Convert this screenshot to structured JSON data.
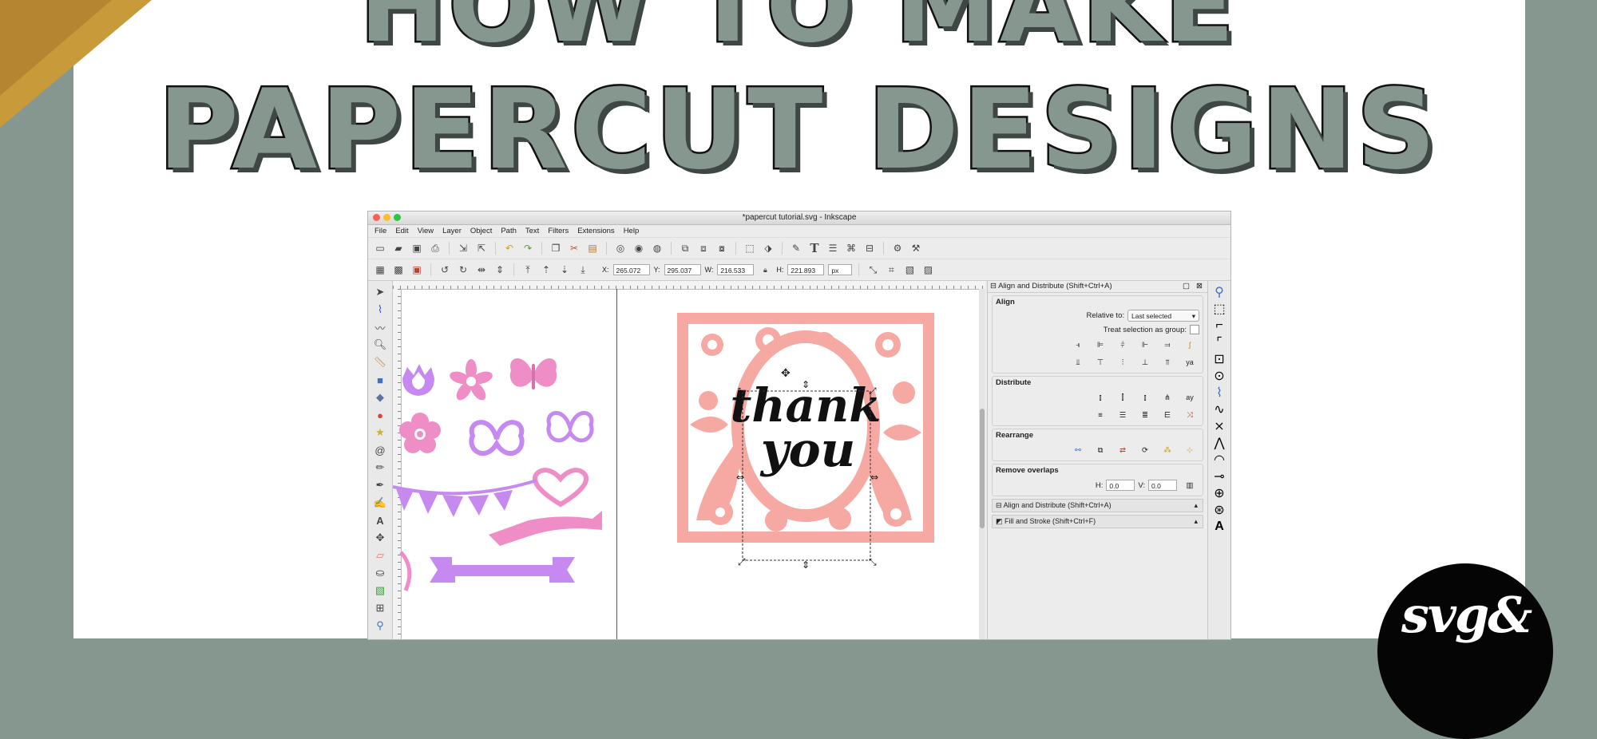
{
  "headline": {
    "line1": "HOW TO MAKE",
    "line2": "PAPERCUT DESIGNS"
  },
  "colors": {
    "sage": "#86978f",
    "peach": "#f6a9a3",
    "purple": "#c589f0",
    "pink": "#ef8ec6",
    "gold": "#c89a3a"
  },
  "window": {
    "title": "*papercut tutorial.svg - Inkscape",
    "menu": [
      "File",
      "Edit",
      "View",
      "Layer",
      "Object",
      "Path",
      "Text",
      "Filters",
      "Extensions",
      "Help"
    ]
  },
  "controls": {
    "x_label": "X:",
    "x_value": "265.072",
    "y_label": "Y:",
    "y_value": "295.037",
    "w_label": "W:",
    "w_value": "216.533",
    "h_label": "H:",
    "h_value": "221.893",
    "unit": "px"
  },
  "canvas": {
    "thank": "thank",
    "you": "you"
  },
  "dock": {
    "header": "Align and Distribute (Shift+Ctrl+A)",
    "align_label": "Align",
    "relative_label": "Relative to:",
    "relative_value": "Last selected",
    "treat_label": "Treat selection as group:",
    "distribute_label": "Distribute",
    "rearrange_label": "Rearrange",
    "overlap_label": "Remove overlaps",
    "h_label": "H:",
    "h_value": "0.0",
    "v_label": "V:",
    "v_value": "0.0",
    "tab1": "Align and Distribute (Shift+Ctrl+A)",
    "tab2": "Fill and Stroke (Shift+Ctrl+F)"
  },
  "logo_text": "svg&"
}
